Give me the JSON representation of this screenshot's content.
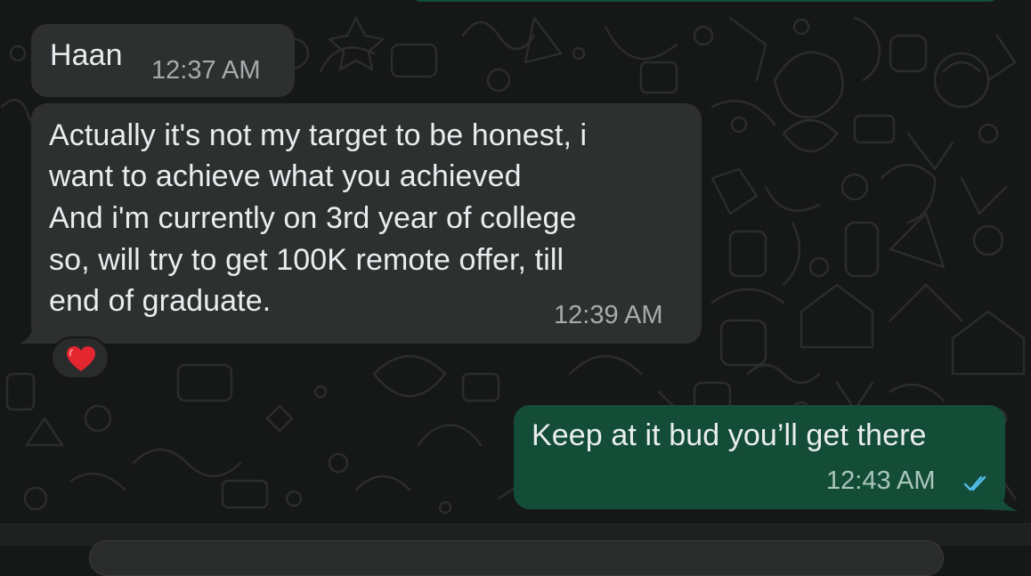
{
  "colors": {
    "background": "#161717",
    "incoming_bubble": "#2e2f2f",
    "outgoing_bubble": "#144d37",
    "text": "#e9edef",
    "read_ticks": "#53bdeb"
  },
  "messages": [
    {
      "direction": "incoming",
      "lines": [
        "Haan"
      ],
      "time": "12:37 AM"
    },
    {
      "direction": "incoming",
      "lines": [
        "Actually it's not my target to be honest, i",
        "want to achieve what you achieved",
        "And i'm currently on 3rd year of college",
        "so, will try to get 100K remote offer, till",
        "end of graduate."
      ],
      "time": "12:39 AM",
      "reaction": {
        "emoji_icon": "red-heart-icon"
      }
    },
    {
      "direction": "outgoing",
      "lines": [
        "Keep at it bud you’ll get there"
      ],
      "time": "12:43 AM",
      "status_icon": "double-check-read-icon"
    }
  ]
}
